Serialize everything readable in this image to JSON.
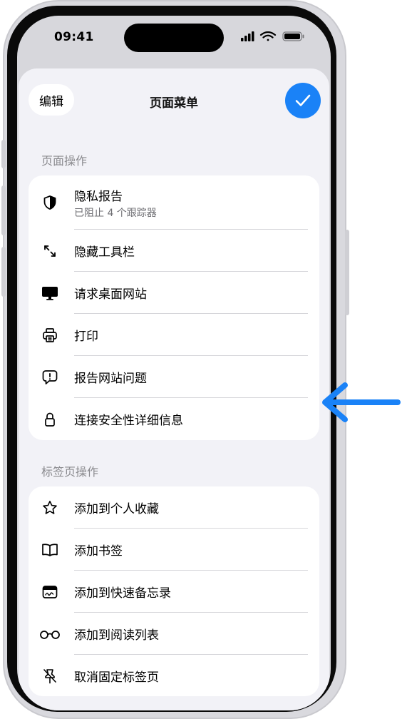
{
  "status_bar": {
    "time": "09:41"
  },
  "sheet": {
    "edit_label": "编辑",
    "title": "页面菜单"
  },
  "page_actions": {
    "header": "页面操作",
    "items": [
      {
        "icon": "shield-icon",
        "label": "隐私报告",
        "subtitle": "已阻止 4 个跟踪器"
      },
      {
        "icon": "hide-toolbar-arrows-icon",
        "label": "隐藏工具栏"
      },
      {
        "icon": "desktop-icon",
        "label": "请求桌面网站"
      },
      {
        "icon": "printer-icon",
        "label": "打印"
      },
      {
        "icon": "report-bubble-icon",
        "label": "报告网站问题"
      },
      {
        "icon": "lock-icon",
        "label": "连接安全性详细信息"
      }
    ]
  },
  "tab_actions": {
    "header": "标签页操作",
    "items": [
      {
        "icon": "star-icon",
        "label": "添加到个人收藏"
      },
      {
        "icon": "book-icon",
        "label": "添加书签"
      },
      {
        "icon": "quick-note-icon",
        "label": "添加到快速备忘录"
      },
      {
        "icon": "glasses-icon",
        "label": "添加到阅读列表"
      },
      {
        "icon": "unpin-icon",
        "label": "取消固定标签页"
      }
    ]
  },
  "colors": {
    "accent": "#1a82f7",
    "callout_arrow": "#1a82f7",
    "sheet_background": "#f2f2f7",
    "secondary_text": "#8a8a8e"
  }
}
